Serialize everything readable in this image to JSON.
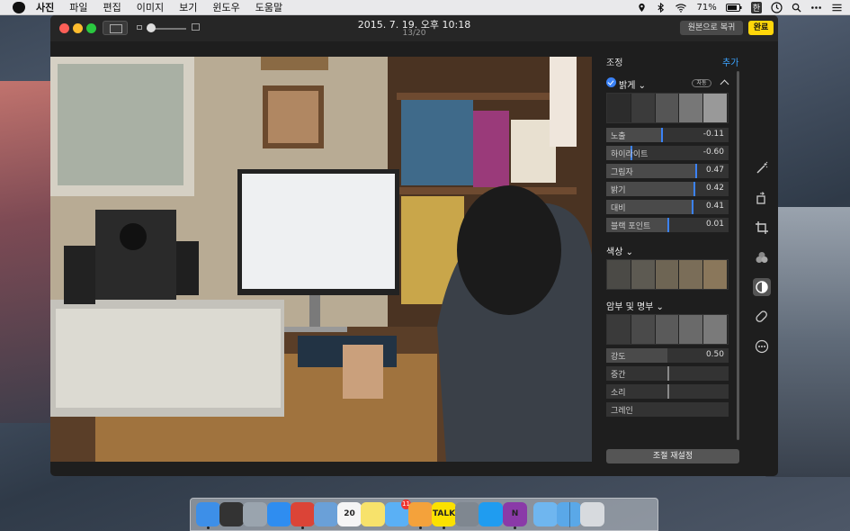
{
  "menubar": {
    "app_name": "사진",
    "items": [
      "파일",
      "편집",
      "이미지",
      "보기",
      "윈도우",
      "도움말"
    ],
    "battery": "71%",
    "input_source": "한"
  },
  "window": {
    "date_title": "2015. 7. 19. 오후 10:18",
    "photo_count": "13/20",
    "revert_label": "원본으로 복귀",
    "done_label": "완료"
  },
  "panel": {
    "title": "조정",
    "add_label": "추가",
    "light": {
      "header": "밝게 ⌄",
      "auto_label": "자동",
      "sliders": [
        {
          "label": "노출",
          "value": "-0.11",
          "level": 0.45
        },
        {
          "label": "하이라이트",
          "value": "-0.60",
          "level": 0.2
        },
        {
          "label": "그림자",
          "value": "0.47",
          "level": 0.73
        },
        {
          "label": "밝기",
          "value": "0.42",
          "level": 0.71
        },
        {
          "label": "대비",
          "value": "0.41",
          "level": 0.7
        },
        {
          "label": "블랙 포인트",
          "value": "0.01",
          "level": 0.5
        }
      ]
    },
    "color": {
      "header": "색상 ⌄"
    },
    "bw": {
      "header": "암부 및 명부 ⌄",
      "sliders": [
        {
          "label": "강도",
          "value": "0.50",
          "level": 0.5,
          "style": "fill"
        },
        {
          "label": "중간",
          "value": "",
          "level": 0.5,
          "style": "mark"
        },
        {
          "label": "소리",
          "value": "",
          "level": 0.5,
          "style": "mark"
        },
        {
          "label": "그레인",
          "value": "",
          "level": 0,
          "style": "none"
        }
      ]
    },
    "reset_label": "조절 재설정"
  },
  "tools": [
    "magic-wand-icon",
    "rotate-icon",
    "crop-icon",
    "filters-icon",
    "adjust-icon",
    "retouch-icon",
    "more-icon"
  ],
  "dock": [
    {
      "name": "finder-icon",
      "color": "#3d8fe8",
      "running": true
    },
    {
      "name": "dashboard-icon",
      "color": "#333333",
      "running": false
    },
    {
      "name": "launchpad-icon",
      "color": "#9aa4ae",
      "running": false
    },
    {
      "name": "safari-icon",
      "color": "#2f8df0",
      "running": false
    },
    {
      "name": "chrome-icon",
      "color": "#db4437",
      "running": true
    },
    {
      "name": "preview-icon",
      "color": "#6aa0d8",
      "running": false
    },
    {
      "name": "calendar-icon",
      "color": "#f5f5f5",
      "running": false,
      "label": "20"
    },
    {
      "name": "notes-icon",
      "color": "#f7e26b",
      "running": false
    },
    {
      "name": "messages-icon",
      "color": "#5ab0f5",
      "running": false,
      "badge": "11"
    },
    {
      "name": "photos-icon",
      "color": "#f4a23b",
      "running": true
    },
    {
      "name": "kakaotalk-icon",
      "color": "#fbe100",
      "running": true,
      "label": "TALK"
    },
    {
      "name": "system-preferences-icon",
      "color": "#7f8790",
      "running": false
    },
    {
      "name": "app-store-icon",
      "color": "#1f9cf0",
      "running": false
    },
    {
      "name": "onenote-icon",
      "color": "#8a3aa8",
      "running": true,
      "label": "N"
    },
    {
      "name": "folder-icon",
      "color": "#6fb6ef",
      "running": false
    },
    {
      "name": "downloads-folder-icon",
      "color": "#5aa8e8",
      "running": false
    },
    {
      "name": "trash-icon",
      "color": "#d7dade",
      "running": false
    }
  ]
}
